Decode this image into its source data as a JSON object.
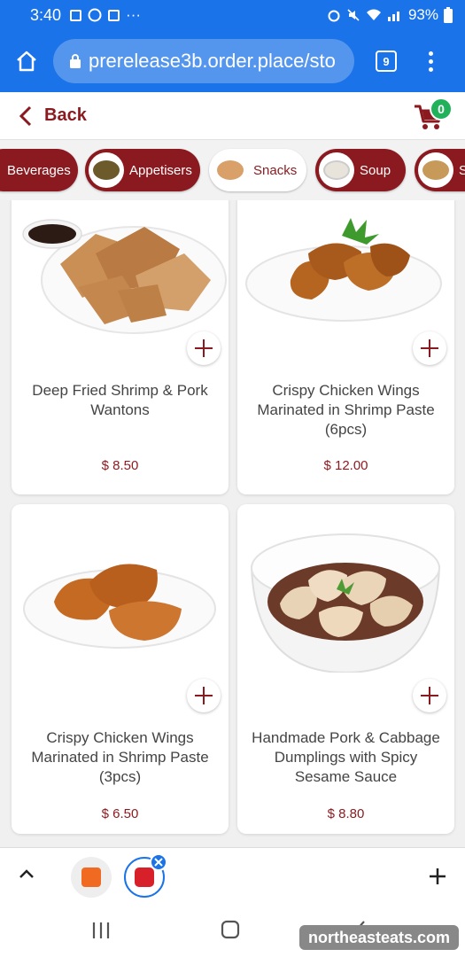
{
  "status_bar": {
    "time": "3:40",
    "dots": "···",
    "battery": "93%"
  },
  "browser": {
    "url": "prerelease3b.order.place/sto",
    "tab_count": "9"
  },
  "header": {
    "back_label": "Back",
    "cart_count": "0"
  },
  "categories": [
    {
      "label": "Beverages",
      "active": true
    },
    {
      "label": "Appetisers",
      "active": true
    },
    {
      "label": "Snacks",
      "active": false
    },
    {
      "label": "Soup",
      "active": true
    },
    {
      "label": "S",
      "active": true
    }
  ],
  "products": [
    {
      "name": "Deep Fried Shrimp & Pork Wantons",
      "price": "$ 8.50"
    },
    {
      "name": "Crispy Chicken Wings Marinated in Shrimp Paste (6pcs)",
      "price": "$ 12.00"
    },
    {
      "name": "Crispy Chicken Wings Marinated in Shrimp Paste (3pcs)",
      "price": "$ 6.50"
    },
    {
      "name": "Handmade Pork & Cabbage Dumplings with Spicy Sesame Sauce",
      "price": "$ 8.80"
    }
  ],
  "watermark": "northeasteats.com",
  "colors": {
    "brand": "#8a1a1f",
    "browser": "#1a73e8",
    "badge": "#21b15b"
  }
}
